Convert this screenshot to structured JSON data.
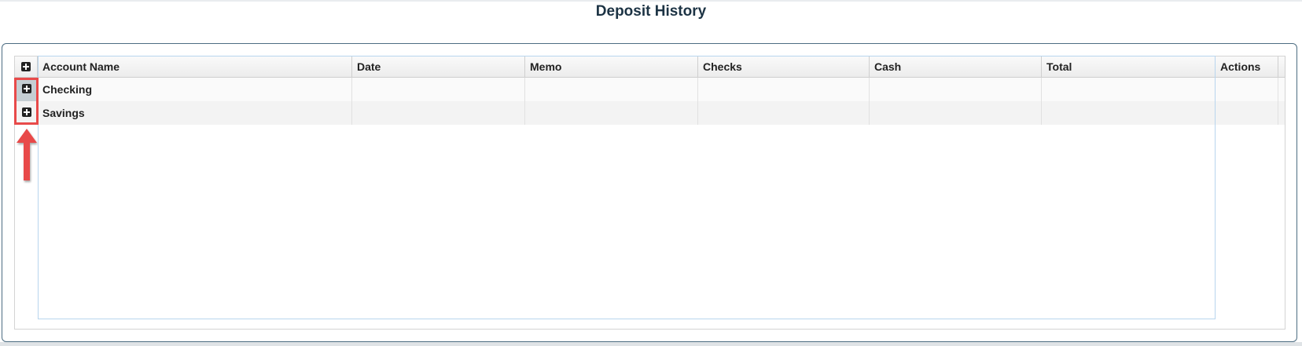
{
  "page": {
    "title": "Deposit History"
  },
  "grid": {
    "columns": [
      {
        "label": "Account Name"
      },
      {
        "label": "Date"
      },
      {
        "label": "Memo"
      },
      {
        "label": "Checks"
      },
      {
        "label": "Cash"
      },
      {
        "label": "Total"
      },
      {
        "label": "Actions"
      }
    ],
    "rows": [
      {
        "account_name": "Checking",
        "date": "",
        "memo": "",
        "checks": "",
        "cash": "",
        "total": "",
        "actions": ""
      },
      {
        "account_name": "Savings",
        "date": "",
        "memo": "",
        "checks": "",
        "cash": "",
        "total": "",
        "actions": ""
      }
    ]
  },
  "annotation": {
    "highlight_color": "#e84a4a"
  }
}
